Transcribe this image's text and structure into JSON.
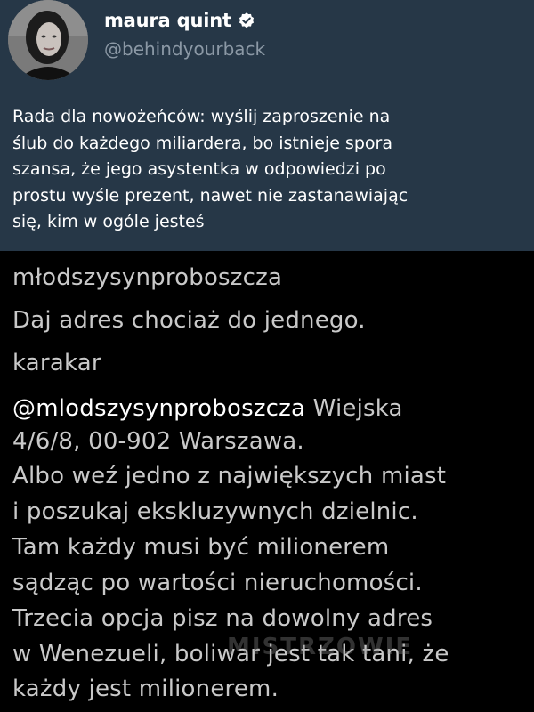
{
  "tweet": {
    "author_name": "maura quint",
    "handle": "@behindyourback",
    "text_lines": [
      "Rada dla nowożeńców: wyślij zaproszenie na",
      "ślub do każdego miliardera, bo istnieje spora",
      "szansa, że jego asystentka w odpowiedzi po",
      "prostu wyśle prezent, nawet nie zastanawiając",
      "się, kim w ogóle jesteś"
    ]
  },
  "comments": [
    {
      "user": "młodszysynproboszcza",
      "lines": [
        "Daj adres chociaż do jednego."
      ]
    },
    {
      "user": "karakar",
      "mention": "@mlodszysynproboszcza",
      "first_line_rest": " Wiejska",
      "lines": [
        "4/6/8, 00-902 Warszawa.",
        "Albo weź jedno z największych miast",
        "i poszukaj ekskluzywnych dzielnic.",
        "Tam każdy musi być milionerem",
        "sądząc po wartości nieruchomości.",
        "Trzecia opcja pisz na dowolny adres",
        "w Wenezueli, boliwar jest tak tani, że",
        "każdy jest milionerem."
      ]
    }
  ],
  "watermark": "MISTRZOWIE",
  "colors": {
    "tweet_bg": "#263747",
    "verified": "#ffffff"
  }
}
